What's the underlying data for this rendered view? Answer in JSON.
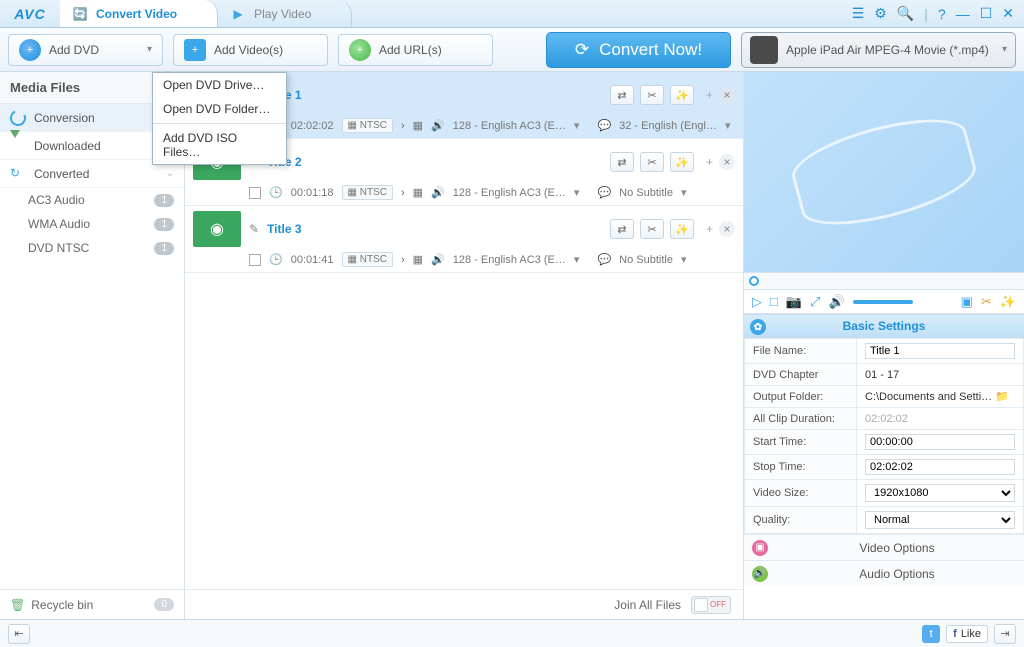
{
  "app": {
    "logo": "AVC"
  },
  "tabs": {
    "convert": "Convert Video",
    "play": "Play Video"
  },
  "toolbar": {
    "add_dvd": "Add DVD",
    "add_videos": "Add Video(s)",
    "add_urls": "Add URL(s)",
    "convert_now": "Convert Now!",
    "profile": "Apple iPad Air MPEG-4 Movie (*.mp4)"
  },
  "dropdown": {
    "open_drive": "Open DVD Drive…",
    "open_folder": "Open DVD Folder…",
    "add_iso": "Add DVD ISO Files…"
  },
  "sidebar": {
    "header": "Media Files",
    "conversion": "Conversion",
    "downloaded": "Downloaded",
    "converted": "Converted",
    "subs": [
      {
        "label": "AC3 Audio",
        "count": "1"
      },
      {
        "label": "WMA Audio",
        "count": "1"
      },
      {
        "label": "DVD NTSC",
        "count": "1"
      }
    ],
    "recycle": "Recycle bin",
    "recycle_count": "0"
  },
  "items": [
    {
      "title": "Title 1",
      "duration": "02:02:02",
      "std": "NTSC",
      "audio": "128 - English AC3 (E…",
      "sub": "32 - English (Engl…"
    },
    {
      "title": "Title 2",
      "duration": "00:01:18",
      "std": "NTSC",
      "audio": "128 - English AC3 (E…",
      "sub": "No Subtitle"
    },
    {
      "title": "Title 3",
      "duration": "00:01:41",
      "std": "NTSC",
      "audio": "128 - English AC3 (E…",
      "sub": "No Subtitle"
    }
  ],
  "center_footer": {
    "join": "Join All Files",
    "toggle": "OFF"
  },
  "settings": {
    "header": "Basic Settings",
    "rows": {
      "file_name_l": "File Name:",
      "file_name_v": "Title 1",
      "chapter_l": "DVD Chapter",
      "chapter_v": "01 -  17",
      "output_l": "Output Folder:",
      "output_v": "C:\\Documents and Setti…",
      "allclip_l": "All Clip Duration:",
      "allclip_v": "02:02:02",
      "start_l": "Start Time:",
      "start_v": "00:00:00",
      "stop_l": "Stop Time:",
      "stop_v": "02:02:02",
      "size_l": "Video Size:",
      "size_v": "1920x1080",
      "quality_l": "Quality:",
      "quality_v": "Normal"
    },
    "video_opts": "Video Options",
    "audio_opts": "Audio Options"
  },
  "bottom": {
    "like": "Like"
  }
}
